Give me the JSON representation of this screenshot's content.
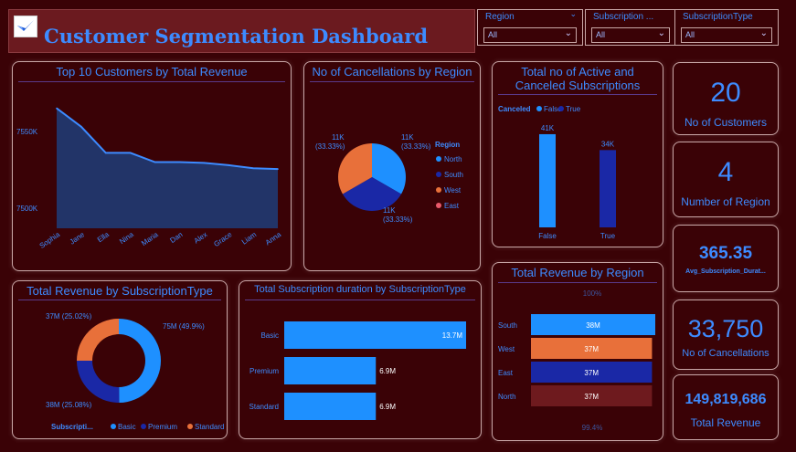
{
  "header": {
    "title": "Customer Segmentation Dashboard"
  },
  "filters": [
    {
      "label": "Region",
      "value": "All"
    },
    {
      "label": "Subscription ...",
      "value": "All"
    },
    {
      "label": "SubscriptionType",
      "value": "All"
    }
  ],
  "kpis": [
    {
      "value": "20",
      "label": "No of Customers"
    },
    {
      "value": "4",
      "label": "Number of Region"
    },
    {
      "value": "365.35",
      "label": "Avg_Subscription_Durat..."
    },
    {
      "value": "33,750",
      "label": "No of Cancellations"
    },
    {
      "value": "149,819,686",
      "label": "Total Revenue"
    }
  ],
  "chart_data": [
    {
      "type": "area",
      "title": "Top 10 Customers by Total Revenue",
      "categories": [
        "Sophia",
        "Jane",
        "Ella",
        "Nina",
        "Maria",
        "Dan",
        "Alex",
        "Grace",
        "Liam",
        "Anna"
      ],
      "values": [
        7565,
        7553,
        7536,
        7536,
        7530,
        7530,
        7529.5,
        7528,
        7526,
        7525.5
      ],
      "yticks": [
        "7550K",
        "7500K"
      ],
      "ytick_values": [
        7550,
        7500
      ],
      "ylim": [
        7487,
        7576
      ],
      "color": "#1f3d7a"
    },
    {
      "type": "pie",
      "title": "No of Cancellations by Region",
      "legend_title": "Region",
      "slices": [
        {
          "name": "North",
          "value": 11,
          "label": "11K\n(33.33%)",
          "color": "#1e90ff"
        },
        {
          "name": "South",
          "value": 11,
          "label": "11K\n(33.33%)",
          "color": "#1a28a6"
        },
        {
          "name": "West",
          "value": 11,
          "label": "11K\n(33.33%)",
          "color": "#e8703a"
        },
        {
          "name": "East",
          "value": 0,
          "label": "",
          "color": "#e85a6a"
        }
      ],
      "pie_labels": [
        "11K",
        "(33.33%)",
        "11K",
        "(33.33%)",
        "11K",
        "(33.33%)"
      ]
    },
    {
      "type": "bar",
      "title": "Total no of Active and Canceled Subscriptions",
      "legend_title": "Canceled",
      "categories": [
        "False",
        "True"
      ],
      "values": [
        41,
        34
      ],
      "labels": [
        "41K",
        "34K"
      ],
      "colors": [
        "#1e90ff",
        "#1a28a6"
      ],
      "ylim": [
        0,
        45
      ]
    },
    {
      "type": "pie",
      "title": "Total Revenue by SubscriptionType",
      "legend_title": "Subscripti...",
      "slices": [
        {
          "name": "Basic",
          "value": 49.9,
          "label": "75M (49.9%)",
          "color": "#1e90ff"
        },
        {
          "name": "Premium",
          "value": 25.08,
          "label": "38M (25.08%)",
          "color": "#1a28a6"
        },
        {
          "name": "Standard",
          "value": 25.02,
          "label": "37M (25.02%)",
          "color": "#e8703a"
        }
      ]
    },
    {
      "type": "bar",
      "title": "Total Subscription duration by SubscriptionType",
      "categories": [
        "Basic",
        "Premium",
        "Standard"
      ],
      "values": [
        13.7,
        6.9,
        6.9
      ],
      "labels": [
        "13.7M",
        "6.9M",
        "6.9M"
      ],
      "color": "#1e90ff",
      "xlim": [
        0,
        14.8
      ]
    },
    {
      "type": "bar",
      "title": "Total Revenue by Region",
      "categories": [
        "South",
        "West",
        "East",
        "North"
      ],
      "values": [
        38,
        37,
        37,
        37
      ],
      "labels": [
        "38M",
        "37M",
        "37M",
        "37M"
      ],
      "colors": [
        "#1e90ff",
        "#e8703a",
        "#1a28a6",
        "#6e1a1e"
      ],
      "top_label": "100%",
      "bottom_label": "99.4%"
    }
  ]
}
